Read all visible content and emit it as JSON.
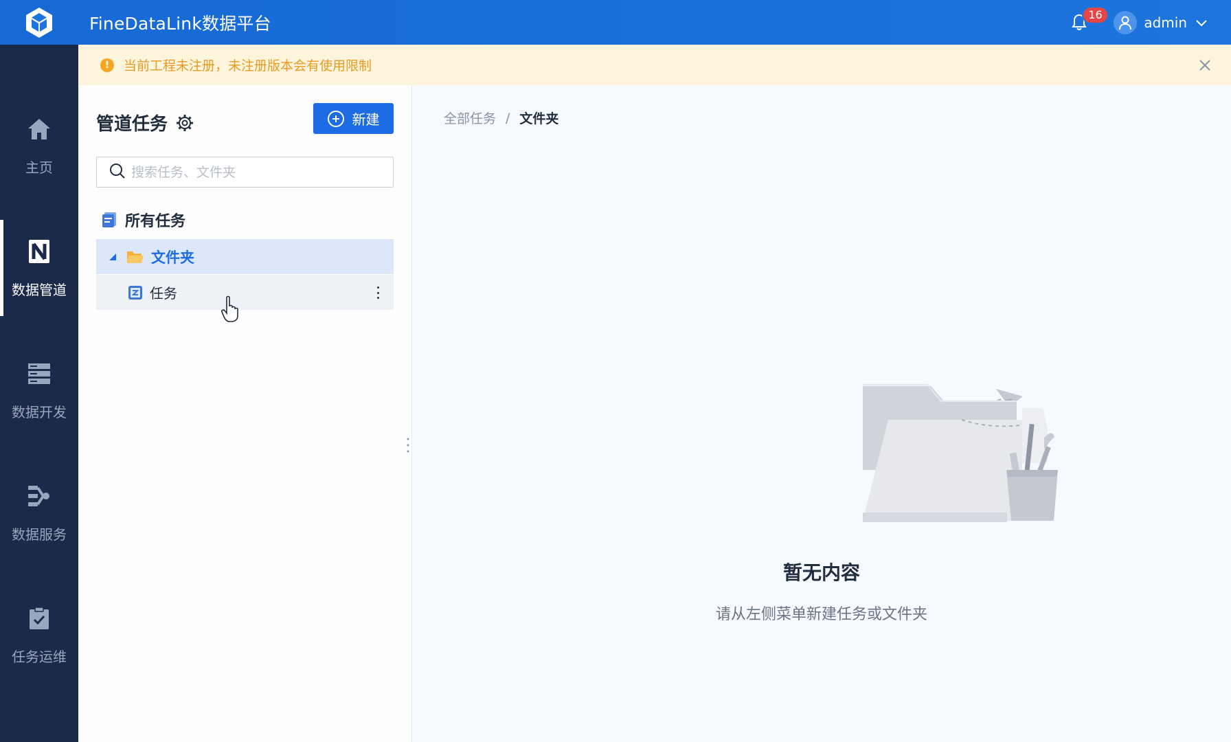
{
  "app": {
    "title": "FineDataLink数据平台"
  },
  "header": {
    "notification_count": "16",
    "user_name": "admin"
  },
  "nav": {
    "items": [
      {
        "label": "主页",
        "icon": "home-icon",
        "active": false
      },
      {
        "label": "数据管道",
        "icon": "pipeline-icon",
        "active": true
      },
      {
        "label": "数据开发",
        "icon": "database-icon",
        "active": false
      },
      {
        "label": "数据服务",
        "icon": "service-icon",
        "active": false
      },
      {
        "label": "任务运维",
        "icon": "clipboard-check-icon",
        "active": false
      }
    ]
  },
  "banner": {
    "text": "当前工程未注册，未注册版本会有使用限制"
  },
  "panel": {
    "title": "管道任务",
    "new_label": "新建",
    "search_placeholder": "搜索任务、文件夹",
    "tree": {
      "all_label": "所有任务",
      "folder_label": "文件夹",
      "task_label": "任务"
    }
  },
  "main": {
    "breadcrumb": {
      "root": "全部任务",
      "separator": "/",
      "current": "文件夹"
    },
    "empty": {
      "title": "暂无内容",
      "subtitle": "请从左侧菜单新建任务或文件夹"
    }
  },
  "colors": {
    "brand": "#1d74dc",
    "nav_bg": "#1b2a4a",
    "primary_button": "#1e6ce3",
    "warning_text": "#e89b25",
    "badge": "#e64545"
  }
}
